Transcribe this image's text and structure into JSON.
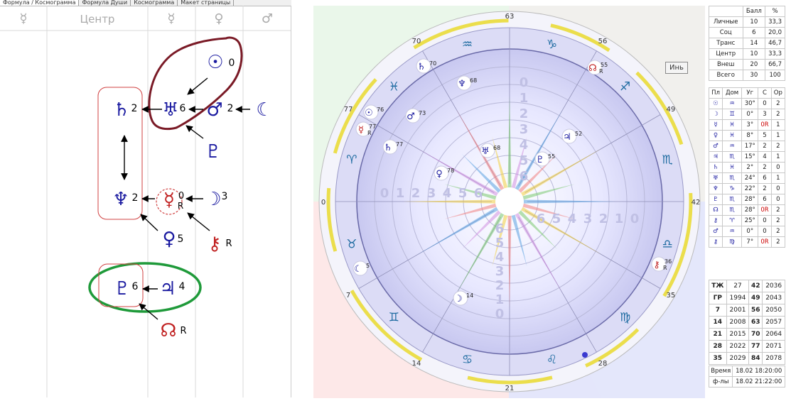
{
  "tabs": [
    "Формула / Космограмма",
    "Формула Души",
    "Космограмма",
    "Макет страницы"
  ],
  "columns": [
    "☿",
    "Центр",
    "☿",
    "♀",
    "♂"
  ],
  "formula": {
    "sun_num": "0",
    "uranus_num": "6",
    "mars_num": "2",
    "saturn_num": "2",
    "neptune_num": "2",
    "mercury_num": "0",
    "mercury_r": "R",
    "moon_num": "3",
    "venus_num": "5",
    "chiron_r": "R",
    "pluto_num": "6",
    "jupiter_num": "4",
    "node_r": "R"
  },
  "chart": {
    "degree_labels": [
      "63",
      "56",
      "49",
      "42",
      "35",
      "28",
      "21",
      "14",
      "7",
      "0",
      "77",
      "70"
    ],
    "sign_ring": [
      "♑",
      "♐",
      "♏",
      "♎",
      "♍",
      "♌",
      "♋",
      "♊",
      "♉",
      "♈",
      "♓",
      "♒"
    ],
    "planet_badges": [
      {
        "glyph": "♄",
        "num": "70",
        "r": ""
      },
      {
        "glyph": "♆",
        "num": "68",
        "r": ""
      },
      {
        "glyph": "☊",
        "num": "55",
        "r": "R"
      },
      {
        "glyph": "☉",
        "num": "76",
        "r": ""
      },
      {
        "glyph": "♂",
        "num": "73",
        "r": ""
      },
      {
        "glyph": "☿",
        "num": "77",
        "r": "R"
      },
      {
        "glyph": "♄",
        "num": "77",
        "r": ""
      },
      {
        "glyph": "♃",
        "num": "52",
        "r": ""
      },
      {
        "glyph": "♅",
        "num": "68",
        "r": ""
      },
      {
        "glyph": "♇",
        "num": "55",
        "r": ""
      },
      {
        "glyph": "♀",
        "num": "78",
        "r": ""
      },
      {
        "glyph": "☾",
        "num": "5",
        "r": ""
      },
      {
        "glyph": "☽",
        "num": "14",
        "r": ""
      },
      {
        "glyph": "⚷",
        "num": "36",
        "r": "R"
      }
    ],
    "scale_numbers": [
      "6",
      "5",
      "4",
      "3",
      "2",
      "1",
      "0"
    ]
  },
  "tooltip": "Инь",
  "scores": {
    "header": [
      "",
      "Балл",
      "%"
    ],
    "rows": [
      [
        "Личные",
        "10",
        "33,3"
      ],
      [
        "Соц",
        "6",
        "20,0"
      ],
      [
        "Транс",
        "14",
        "46,7"
      ],
      [
        "Центр",
        "10",
        "33,3"
      ],
      [
        "Внеш",
        "20",
        "66,7"
      ],
      [
        "Всего",
        "30",
        "100"
      ]
    ]
  },
  "planets": {
    "header": [
      "Пл",
      "Дом",
      "Уг",
      "С",
      "Ор"
    ],
    "rows": [
      [
        "☉",
        "♒",
        "30°",
        "0",
        "2"
      ],
      [
        "☽",
        "♊",
        "0°",
        "3",
        "2"
      ],
      [
        "☿",
        "♓",
        "3°",
        "0R",
        "1"
      ],
      [
        "♀",
        "♓",
        "8°",
        "5",
        "1"
      ],
      [
        "♂",
        "♒",
        "17°",
        "2",
        "2"
      ],
      [
        "♃",
        "♏",
        "15°",
        "4",
        "1"
      ],
      [
        "♄",
        "♓",
        "2°",
        "2",
        "0"
      ],
      [
        "♅",
        "♏",
        "24°",
        "6",
        "1"
      ],
      [
        "♆",
        "♑",
        "22°",
        "2",
        "0"
      ],
      [
        "♇",
        "♏",
        "28°",
        "6",
        "0"
      ],
      [
        "☊",
        "♏",
        "28°",
        "0R",
        "2"
      ],
      [
        "⚷",
        "♈",
        "25°",
        "0",
        "2"
      ],
      [
        "♂",
        "♒",
        "0°",
        "0",
        "2"
      ],
      [
        "⚷",
        "♍",
        "7°",
        "0R",
        "2"
      ]
    ]
  },
  "years": {
    "rows": [
      [
        "ТЖ",
        "27",
        "42",
        "2036"
      ],
      [
        "ГР",
        "1994",
        "49",
        "2043"
      ],
      [
        "7",
        "2001",
        "56",
        "2050"
      ],
      [
        "14",
        "2008",
        "63",
        "2057"
      ],
      [
        "21",
        "2015",
        "70",
        "2064"
      ],
      [
        "28",
        "2022",
        "77",
        "2071"
      ],
      [
        "35",
        "2029",
        "84",
        "2078"
      ]
    ]
  },
  "times": {
    "rows": [
      [
        "Время",
        "18.02 18:20:00"
      ],
      [
        "ф-лы",
        "18.02 21:22:00"
      ]
    ]
  }
}
